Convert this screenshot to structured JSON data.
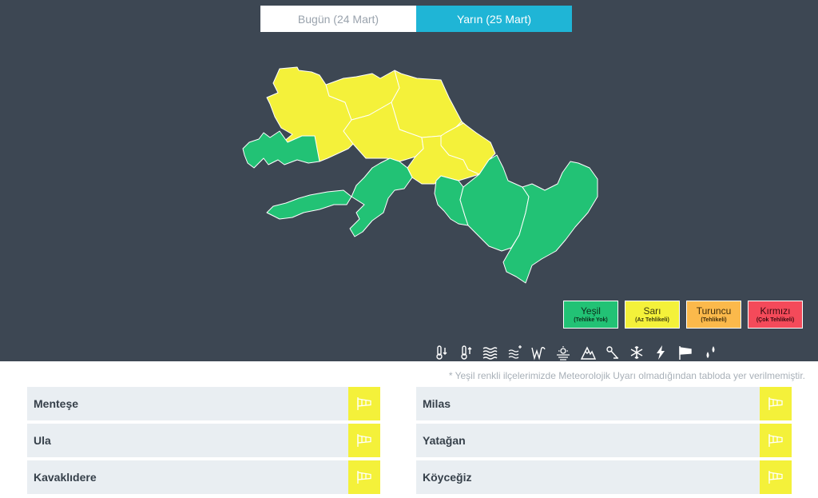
{
  "tabs": [
    {
      "label": "Bugün (24 Mart)",
      "active": false
    },
    {
      "label": "Yarın (25 Mart)",
      "active": true
    }
  ],
  "colors": {
    "yesil": "#22c275",
    "sari": "#f4f13a",
    "turuncu": "#fbb94b",
    "kirmizi": "#f44a5a",
    "background": "#3d4753",
    "accent": "#1fb5d6"
  },
  "map": {
    "district_levels": {
      "Milas": "sari",
      "Yatağan": "sari",
      "Kavaklıdere": "sari",
      "Menteşe": "sari",
      "Ula": "sari",
      "Köyceğiz": "sari",
      "Bodrum": "yesil",
      "Datça": "yesil",
      "Marmaris": "yesil",
      "Ortaca": "yesil",
      "Dalaman": "yesil",
      "Fethiye": "yesil",
      "Seydikemer": "yesil"
    }
  },
  "legend": [
    {
      "name": "Yeşil",
      "sub": "(Tehlike Yok)",
      "color": "#22c275"
    },
    {
      "name": "Sarı",
      "sub": "(Az Tehlikeli)",
      "color": "#f4f13a"
    },
    {
      "name": "Turuncu",
      "sub": "(Tehlikeli)",
      "color": "#fbb94b"
    },
    {
      "name": "Kırmızı",
      "sub": "(Çok Tehlikeli)",
      "color": "#f44a5a"
    }
  ],
  "hazard_icons": [
    "low-temperature-icon",
    "high-temperature-icon",
    "fog-icon",
    "snow-rain-icon",
    "storm-wave-icon",
    "dust-icon",
    "avalanche-icon",
    "ice-icon",
    "snow-icon",
    "lightning-icon",
    "wind-icon",
    "rain-icon"
  ],
  "note": "* Yeşil renkli ilçelerimizde Meteorolojik Uyarı olmadığından tabloda yer verilmemiştir.",
  "warnings": [
    {
      "district": "Menteşe",
      "icon": "wind-icon"
    },
    {
      "district": "Milas",
      "icon": "wind-icon"
    },
    {
      "district": "Ula",
      "icon": "wind-icon"
    },
    {
      "district": "Yatağan",
      "icon": "wind-icon"
    },
    {
      "district": "Kavaklıdere",
      "icon": "wind-icon"
    },
    {
      "district": "Köyceğiz",
      "icon": "wind-icon"
    }
  ]
}
